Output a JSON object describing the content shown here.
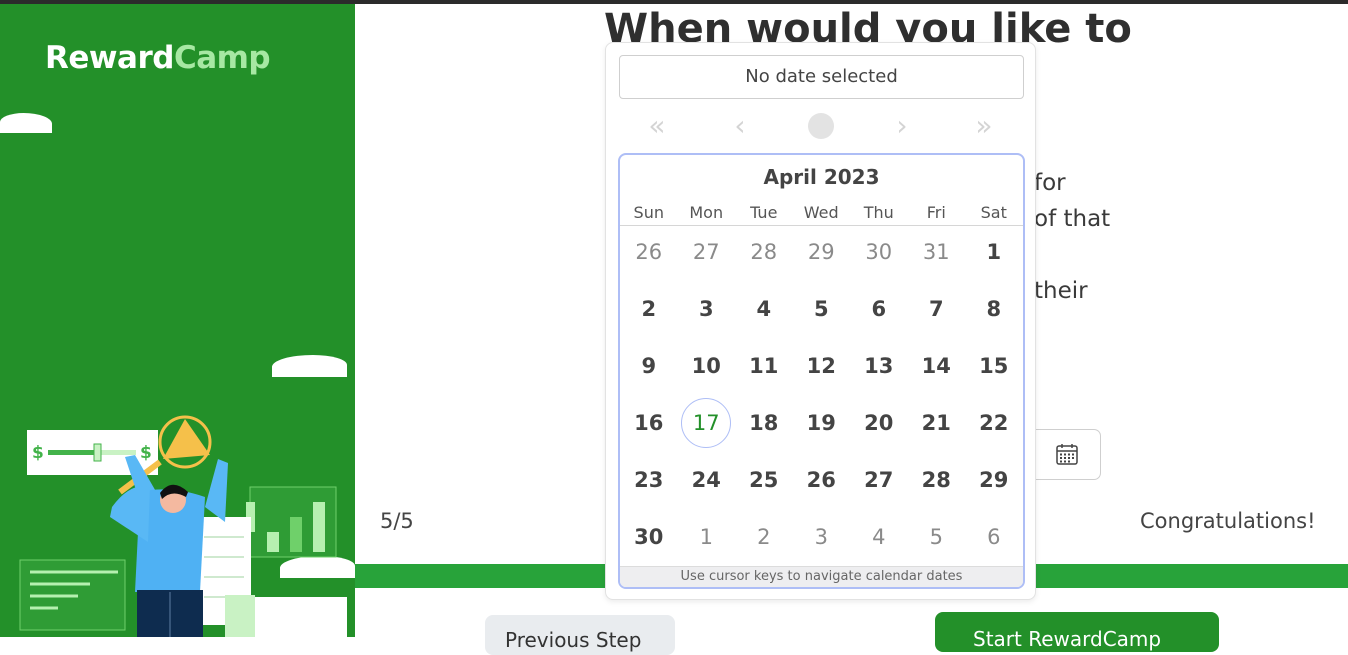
{
  "app": {
    "logo_part1": "Reward",
    "logo_part2": "Camp"
  },
  "main": {
    "title": "When would you like to",
    "bg_fragments": [
      "for",
      "of that",
      "their"
    ],
    "step": "5/5",
    "congrats": "Congratulations!",
    "prev_label": "Previous Step",
    "next_label": "Start RewardCamp"
  },
  "datepicker": {
    "selected_value": "No date selected",
    "nav": {
      "prev_year": "«",
      "prev_month": "‹",
      "next_month": "›",
      "next_year": "»"
    },
    "month_label": "April 2023",
    "weekdays": [
      "Sun",
      "Mon",
      "Tue",
      "Wed",
      "Thu",
      "Fri",
      "Sat"
    ],
    "weeks": [
      [
        "26",
        "27",
        "28",
        "29",
        "30",
        "31",
        "1"
      ],
      [
        "2",
        "3",
        "4",
        "5",
        "6",
        "7",
        "8"
      ],
      [
        "9",
        "10",
        "11",
        "12",
        "13",
        "14",
        "15"
      ],
      [
        "16",
        "17",
        "18",
        "19",
        "20",
        "21",
        "22"
      ],
      [
        "23",
        "24",
        "25",
        "26",
        "27",
        "28",
        "29"
      ],
      [
        "30",
        "1",
        "2",
        "3",
        "4",
        "5",
        "6"
      ]
    ],
    "today": "17",
    "hint": "Use cursor keys to navigate calendar dates"
  },
  "illustration": {
    "currency_left": "$",
    "currency_right": "$"
  },
  "colors": {
    "brand_green": "#239029",
    "accent_light": "#a7e8a3",
    "focus_blue": "#aebef6",
    "progress": "#28a33a"
  }
}
